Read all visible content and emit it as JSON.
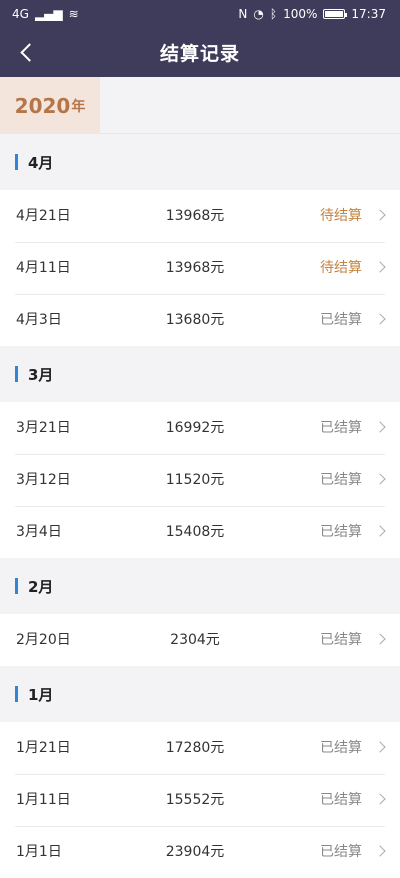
{
  "status": {
    "time": "17:37",
    "battery": "100%",
    "network": "4G"
  },
  "nav": {
    "title": "结算记录"
  },
  "year": {
    "num": "2020",
    "unit": "年"
  },
  "months": [
    {
      "label": "4月",
      "rows": [
        {
          "date": "4月21日",
          "amount": "13968元",
          "status": "待结算",
          "pending": true
        },
        {
          "date": "4月11日",
          "amount": "13968元",
          "status": "待结算",
          "pending": true
        },
        {
          "date": "4月3日",
          "amount": "13680元",
          "status": "已结算",
          "pending": false
        }
      ]
    },
    {
      "label": "3月",
      "rows": [
        {
          "date": "3月21日",
          "amount": "16992元",
          "status": "已结算",
          "pending": false
        },
        {
          "date": "3月12日",
          "amount": "11520元",
          "status": "已结算",
          "pending": false
        },
        {
          "date": "3月4日",
          "amount": "15408元",
          "status": "已结算",
          "pending": false
        }
      ]
    },
    {
      "label": "2月",
      "rows": [
        {
          "date": "2月20日",
          "amount": "2304元",
          "status": "已结算",
          "pending": false
        }
      ]
    },
    {
      "label": "1月",
      "rows": [
        {
          "date": "1月21日",
          "amount": "17280元",
          "status": "已结算",
          "pending": false
        },
        {
          "date": "1月11日",
          "amount": "15552元",
          "status": "已结算",
          "pending": false
        },
        {
          "date": "1月1日",
          "amount": "23904元",
          "status": "已结算",
          "pending": false
        }
      ]
    }
  ]
}
